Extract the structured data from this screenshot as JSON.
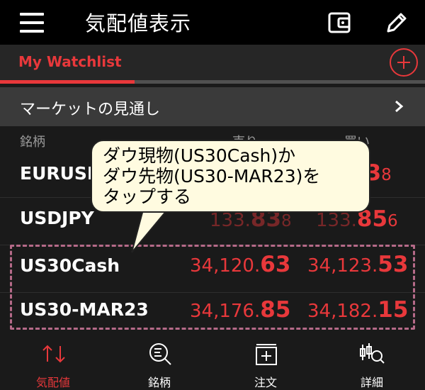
{
  "header": {
    "title": "気配値表示"
  },
  "tabs": {
    "active_label": "My Watchlist"
  },
  "market_row": {
    "label": "マーケットの見通し"
  },
  "columns": {
    "symbol": "銘柄",
    "sell": "売り",
    "buy": "買い"
  },
  "rows": [
    {
      "symbol": "EURUSD",
      "sell": {
        "a": "",
        "b": "",
        "c": ""
      },
      "buy": {
        "a": "",
        "b": "03",
        "c": "8"
      }
    },
    {
      "symbol": "USDJPY",
      "sell": {
        "a": "133.",
        "b": "83",
        "c": "8"
      },
      "buy": {
        "a": "133.",
        "b": "85",
        "c": "6"
      }
    },
    {
      "symbol": "US30Cash",
      "sell": {
        "a": "34,120.",
        "b": "63",
        "c": ""
      },
      "buy": {
        "a": "34,123.",
        "b": "53",
        "c": ""
      }
    },
    {
      "symbol": "US30-MAR23",
      "sell": {
        "a": "34,176.",
        "b": "85",
        "c": ""
      },
      "buy": {
        "a": "34,182.",
        "b": "15",
        "c": ""
      }
    }
  ],
  "callout": {
    "text": "ダウ現物(US30Cash)か\nダウ先物(US30-MAR23)を\nタップする"
  },
  "nav": [
    {
      "label": "気配値",
      "icon": "quotes-arrows-icon"
    },
    {
      "label": "銘柄",
      "icon": "symbol-search-icon"
    },
    {
      "label": "注文",
      "icon": "order-icon"
    },
    {
      "label": "詳細",
      "icon": "chart-detail-icon"
    }
  ],
  "colors": {
    "accent": "#e8383b",
    "callout_bg": "#fffbe0",
    "highlight_dash": "#b56a88"
  }
}
